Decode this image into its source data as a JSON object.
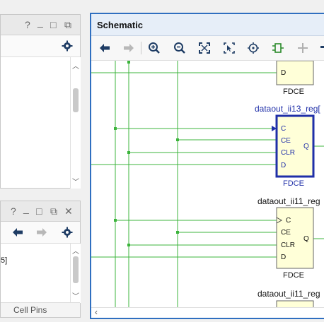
{
  "left_top_panel": {
    "controls": {
      "help": "?",
      "minimize": "_",
      "maximize": "□",
      "restore": "⧉"
    },
    "settings_icon": "gear-icon"
  },
  "left_bottom_panel": {
    "controls": {
      "help": "?",
      "minimize": "_",
      "maximize": "□",
      "restore": "⧉",
      "close": "✕"
    },
    "visible_text": "5]",
    "tab_label": "Cell Pins"
  },
  "schematic": {
    "title": "Schematic",
    "toolbar": [
      "back-icon",
      "forward-icon",
      "zoom-in-icon",
      "zoom-out-icon",
      "fit-icon",
      "zoom-area-icon",
      "center-icon",
      "regenerate-icon",
      "add-icon",
      "more-icon"
    ],
    "cells": [
      {
        "name": "",
        "type": "FDCE",
        "pins": [
          "D"
        ],
        "selected": false
      },
      {
        "name": "dataout_ii13_reg[",
        "type": "FDCE",
        "pins": [
          "C",
          "CE",
          "CLR",
          "D"
        ],
        "out_pin": "Q",
        "selected": true
      },
      {
        "name": "dataout_ii11_reg",
        "type": "FDCE",
        "pins": [
          "C",
          "CE",
          "CLR",
          "D"
        ],
        "out_pin": "Q",
        "selected": false
      },
      {
        "name": "dataout_ii11_reg",
        "type": "",
        "pins": [],
        "selected": false
      }
    ],
    "colors": {
      "wire": "#3cb43c",
      "cell_fill": "#ffffd8",
      "selected": "#1f2fa8",
      "label_selected": "#1f2fa8"
    }
  }
}
